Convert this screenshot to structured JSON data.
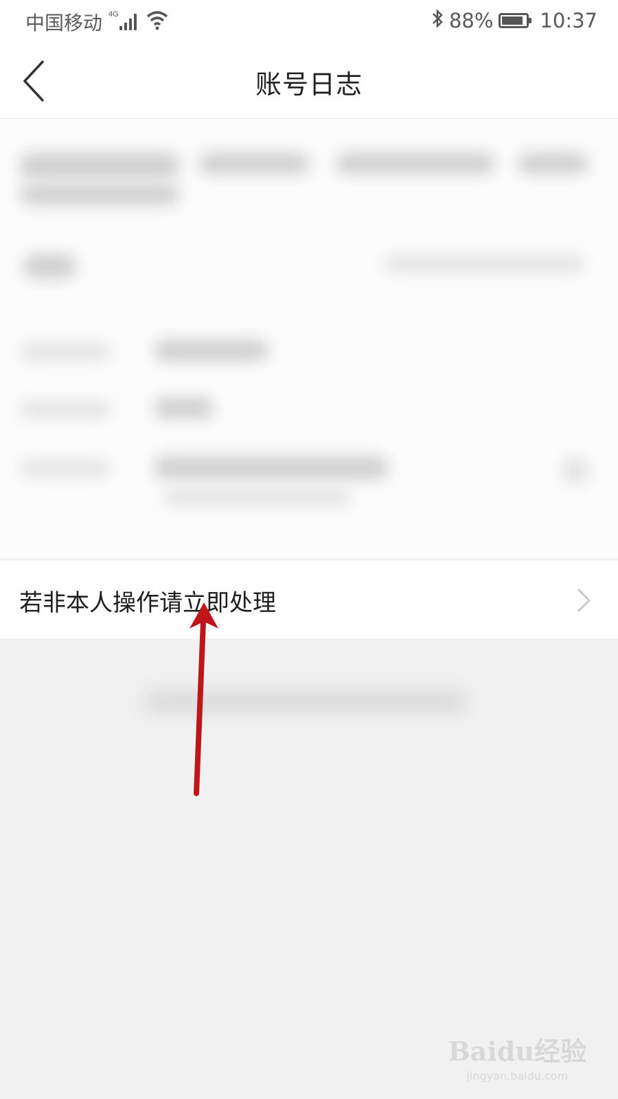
{
  "status_bar": {
    "carrier": "中国移动",
    "network": "4G",
    "battery_percent": "88%",
    "battery_level": 0.88,
    "time": "10:37",
    "icons": [
      "signal-icon",
      "wifi-icon",
      "bluetooth-icon",
      "battery-icon"
    ]
  },
  "header": {
    "title": "账号日志",
    "back_icon": "back-arrow-icon"
  },
  "main": {
    "action_label": "若非本人操作请立即处理",
    "action_icon": "chevron-right-icon"
  },
  "annotation": {
    "color": "#c0161a"
  },
  "watermark": {
    "brand": "Baidu经验",
    "url": "jingyan.baidu.com"
  }
}
